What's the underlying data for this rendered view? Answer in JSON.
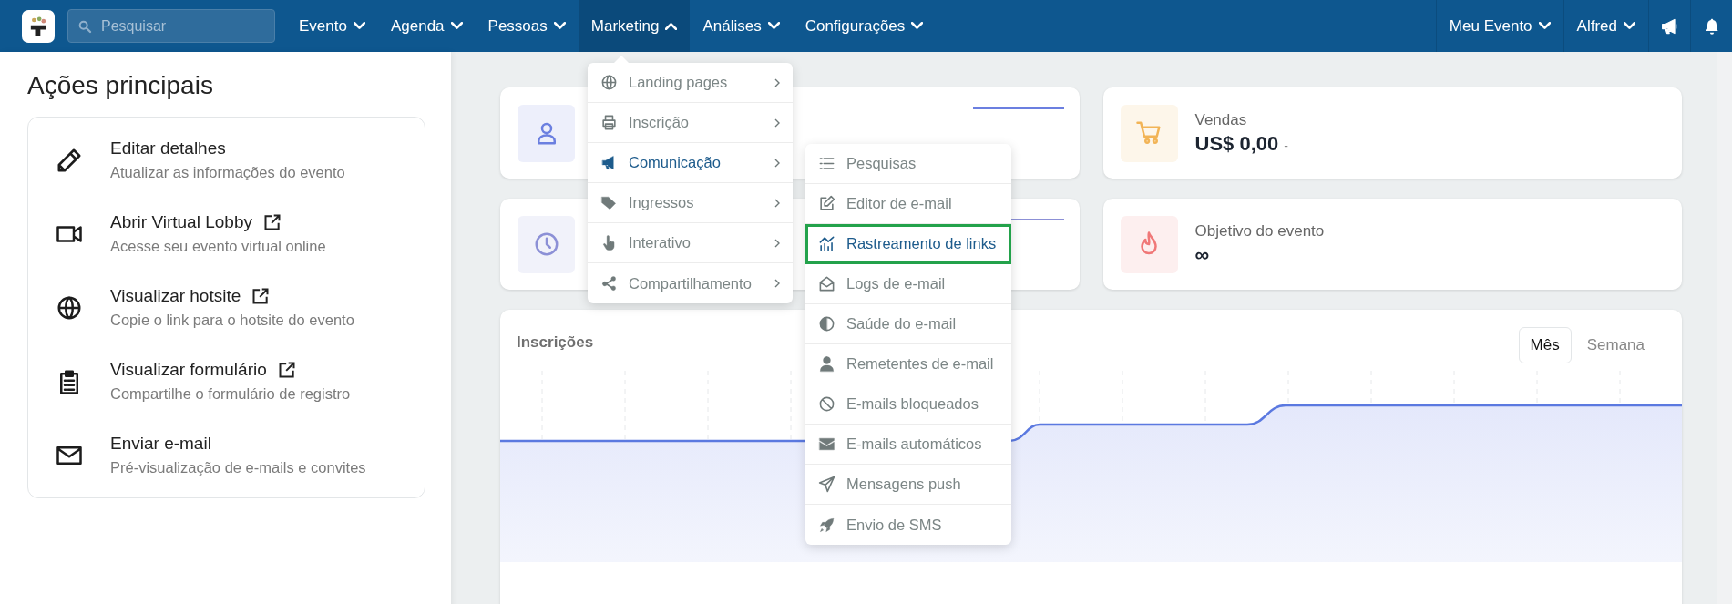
{
  "nav": {
    "search_placeholder": "Pesquisar",
    "items": [
      {
        "label": "Evento",
        "expanded": false
      },
      {
        "label": "Agenda",
        "expanded": false
      },
      {
        "label": "Pessoas",
        "expanded": false
      },
      {
        "label": "Marketing",
        "expanded": true
      },
      {
        "label": "Análises",
        "expanded": false
      },
      {
        "label": "Configurações",
        "expanded": false
      }
    ],
    "right_items": [
      {
        "label": "Meu Evento",
        "expanded": false
      },
      {
        "label": "Alfred",
        "expanded": false
      }
    ]
  },
  "sidebar": {
    "title": "Ações principais",
    "actions": [
      {
        "title": "Editar detalhes",
        "subtitle": "Atualizar as informações do evento",
        "external": false
      },
      {
        "title": "Abrir Virtual Lobby",
        "subtitle": "Acesse seu evento virtual online",
        "external": true
      },
      {
        "title": "Visualizar hotsite",
        "subtitle": "Copie o link para o hotsite do evento",
        "external": true
      },
      {
        "title": "Visualizar formulário",
        "subtitle": "Compartilhe o formulário de registro",
        "external": true
      },
      {
        "title": "Enviar e-mail",
        "subtitle": "Pré-visualização de e-mails e convites",
        "external": false
      }
    ]
  },
  "marketing_menu": [
    {
      "label": "Landing pages",
      "selected": false
    },
    {
      "label": "Inscrição",
      "selected": false
    },
    {
      "label": "Comunicação",
      "selected": true
    },
    {
      "label": "Ingressos",
      "selected": false
    },
    {
      "label": "Interativo",
      "selected": false
    },
    {
      "label": "Compartilhamento",
      "selected": false
    }
  ],
  "communication_submenu": [
    {
      "label": "Pesquisas",
      "selected": false
    },
    {
      "label": "Editor de e-mail",
      "selected": false
    },
    {
      "label": "Rastreamento de links",
      "selected": true
    },
    {
      "label": "Logs de e-mail",
      "selected": false
    },
    {
      "label": "Saúde do e-mail",
      "selected": false
    },
    {
      "label": "Remetentes de e-mail",
      "selected": false
    },
    {
      "label": "E-mails bloqueados",
      "selected": false
    },
    {
      "label": "E-mails automáticos",
      "selected": false
    },
    {
      "label": "Mensagens push",
      "selected": false
    },
    {
      "label": "Envio de SMS",
      "selected": false
    }
  ],
  "stat_cards": [
    {
      "kind": "trend",
      "color": "#6b7fe0"
    },
    {
      "kind": "stat",
      "color": "#f2b456",
      "label": "Vendas",
      "value": "US$ 0,00",
      "change": "-"
    },
    {
      "kind": "trend",
      "color": "#8c90d6"
    },
    {
      "kind": "stat",
      "color": "#f07878",
      "label": "Objetivo do evento",
      "value": "∞"
    }
  ],
  "chart": {
    "title": "Inscrições",
    "periods": [
      {
        "label": "Mês",
        "selected": true
      },
      {
        "label": "Semana",
        "selected": false
      }
    ]
  }
}
